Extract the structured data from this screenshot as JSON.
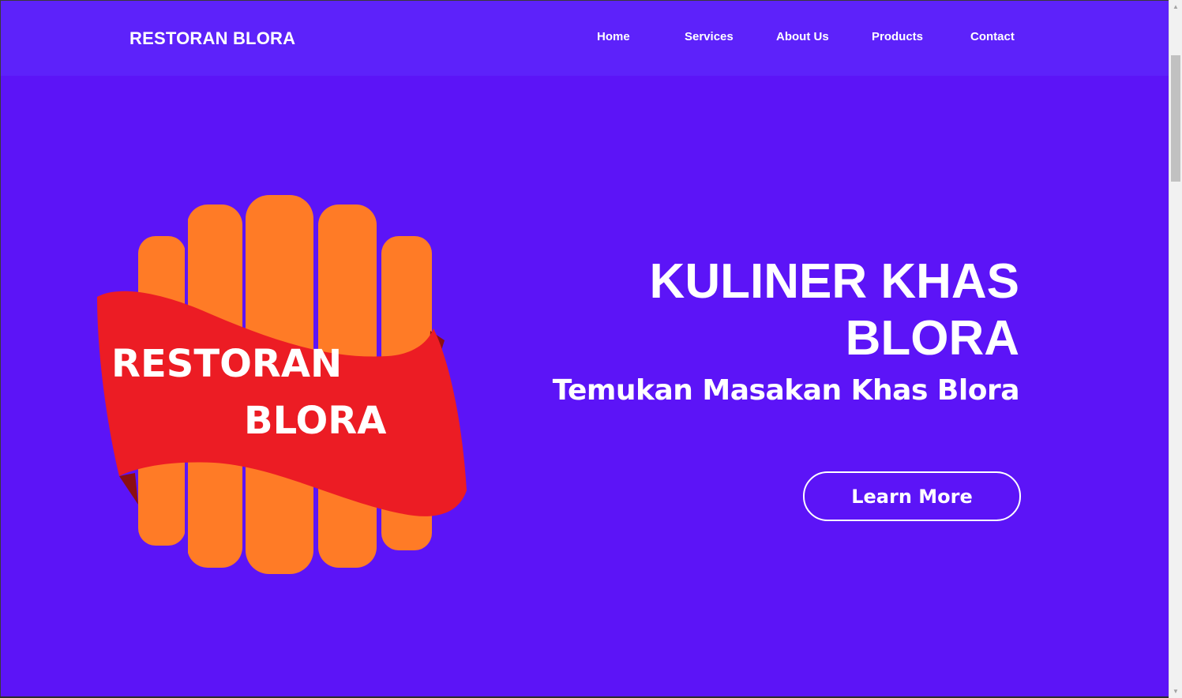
{
  "nav": {
    "brand": "RESTORAN BLORA",
    "items": [
      {
        "label": "Home"
      },
      {
        "label": "Services"
      },
      {
        "label": "About Us"
      },
      {
        "label": "Products"
      },
      {
        "label": "Contact"
      }
    ]
  },
  "hero": {
    "logo_text_line1": "RESTORAN",
    "logo_text_line2": "BLORA",
    "title_line1": "KULINER KHAS",
    "title_line2": "BLORA",
    "subtitle": "Temukan Masakan Khas Blora",
    "cta_label": "Learn More"
  },
  "colors": {
    "background": "#5c14f7",
    "navbar": "#5d22fa",
    "logo_orange": "#ff7b26",
    "logo_red": "#ec1c24",
    "logo_dark_red": "#8b0f12",
    "text": "#ffffff"
  },
  "icons": {
    "scroll_up": "triangle-up-icon",
    "scroll_down": "triangle-down-icon"
  }
}
